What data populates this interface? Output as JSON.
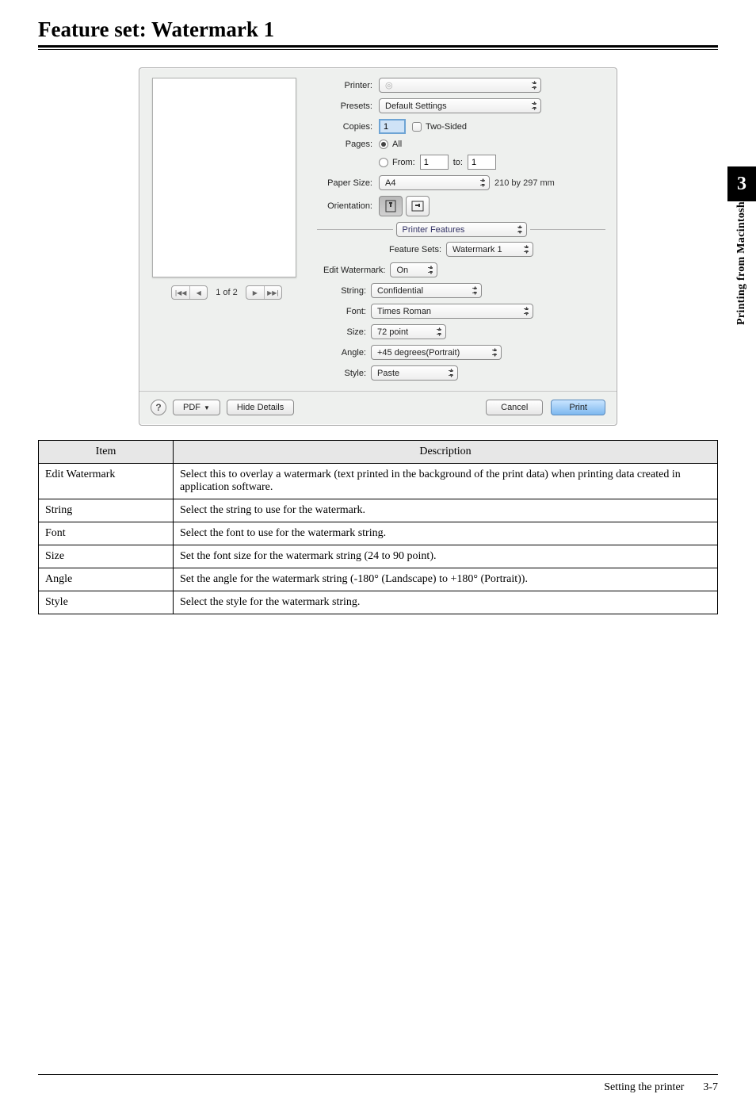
{
  "heading": "Feature set: Watermark 1",
  "side_tab": {
    "number": "3",
    "label": "Printing from Macintosh"
  },
  "dialog": {
    "printer_label": "Printer:",
    "printer_value": "◎",
    "presets_label": "Presets:",
    "presets_value": "Default Settings",
    "copies_label": "Copies:",
    "copies_value": "1",
    "two_sided": "Two-Sided",
    "pages_label": "Pages:",
    "pages_all": "All",
    "pages_from_label": "From:",
    "pages_from_value": "1",
    "pages_to_label": "to:",
    "pages_to_value": "1",
    "paper_size_label": "Paper Size:",
    "paper_size_value": "A4",
    "paper_dim": "210 by 297 mm",
    "orientation_label": "Orientation:",
    "section_title": "Printer Features",
    "feature_sets_label": "Feature Sets:",
    "feature_sets_value": "Watermark 1",
    "edit_watermark_label": "Edit Watermark:",
    "edit_watermark_value": "On",
    "string_label": "String:",
    "string_value": "Confidential",
    "font_label": "Font:",
    "font_value": "Times Roman",
    "size_label": "Size:",
    "size_value": "72 point",
    "angle_label": "Angle:",
    "angle_value": "+45 degrees(Portrait)",
    "style_label": "Style:",
    "style_value": "Paste",
    "preview_page": "1 of 2",
    "help": "?",
    "pdf_label": "PDF",
    "hide_details": "Hide Details",
    "cancel": "Cancel",
    "print": "Print"
  },
  "table": {
    "headers": {
      "item": "Item",
      "desc": "Description"
    },
    "rows": [
      {
        "item": "Edit Watermark",
        "desc": "Select this to overlay a watermark (text printed in the background of the print data) when printing data created in application software."
      },
      {
        "item": "String",
        "desc": "Select the string to use for the watermark."
      },
      {
        "item": "Font",
        "desc": "Select the font to use for the watermark string."
      },
      {
        "item": "Size",
        "desc": "Set the font size for the watermark string (24 to 90 point)."
      },
      {
        "item": "Angle",
        "desc": "Set the angle for the watermark string (-180° (Landscape) to +180° (Portrait))."
      },
      {
        "item": "Style",
        "desc": "Select the style for the watermark string."
      }
    ]
  },
  "footer": {
    "section": "Setting the printer",
    "page": "3-7"
  }
}
